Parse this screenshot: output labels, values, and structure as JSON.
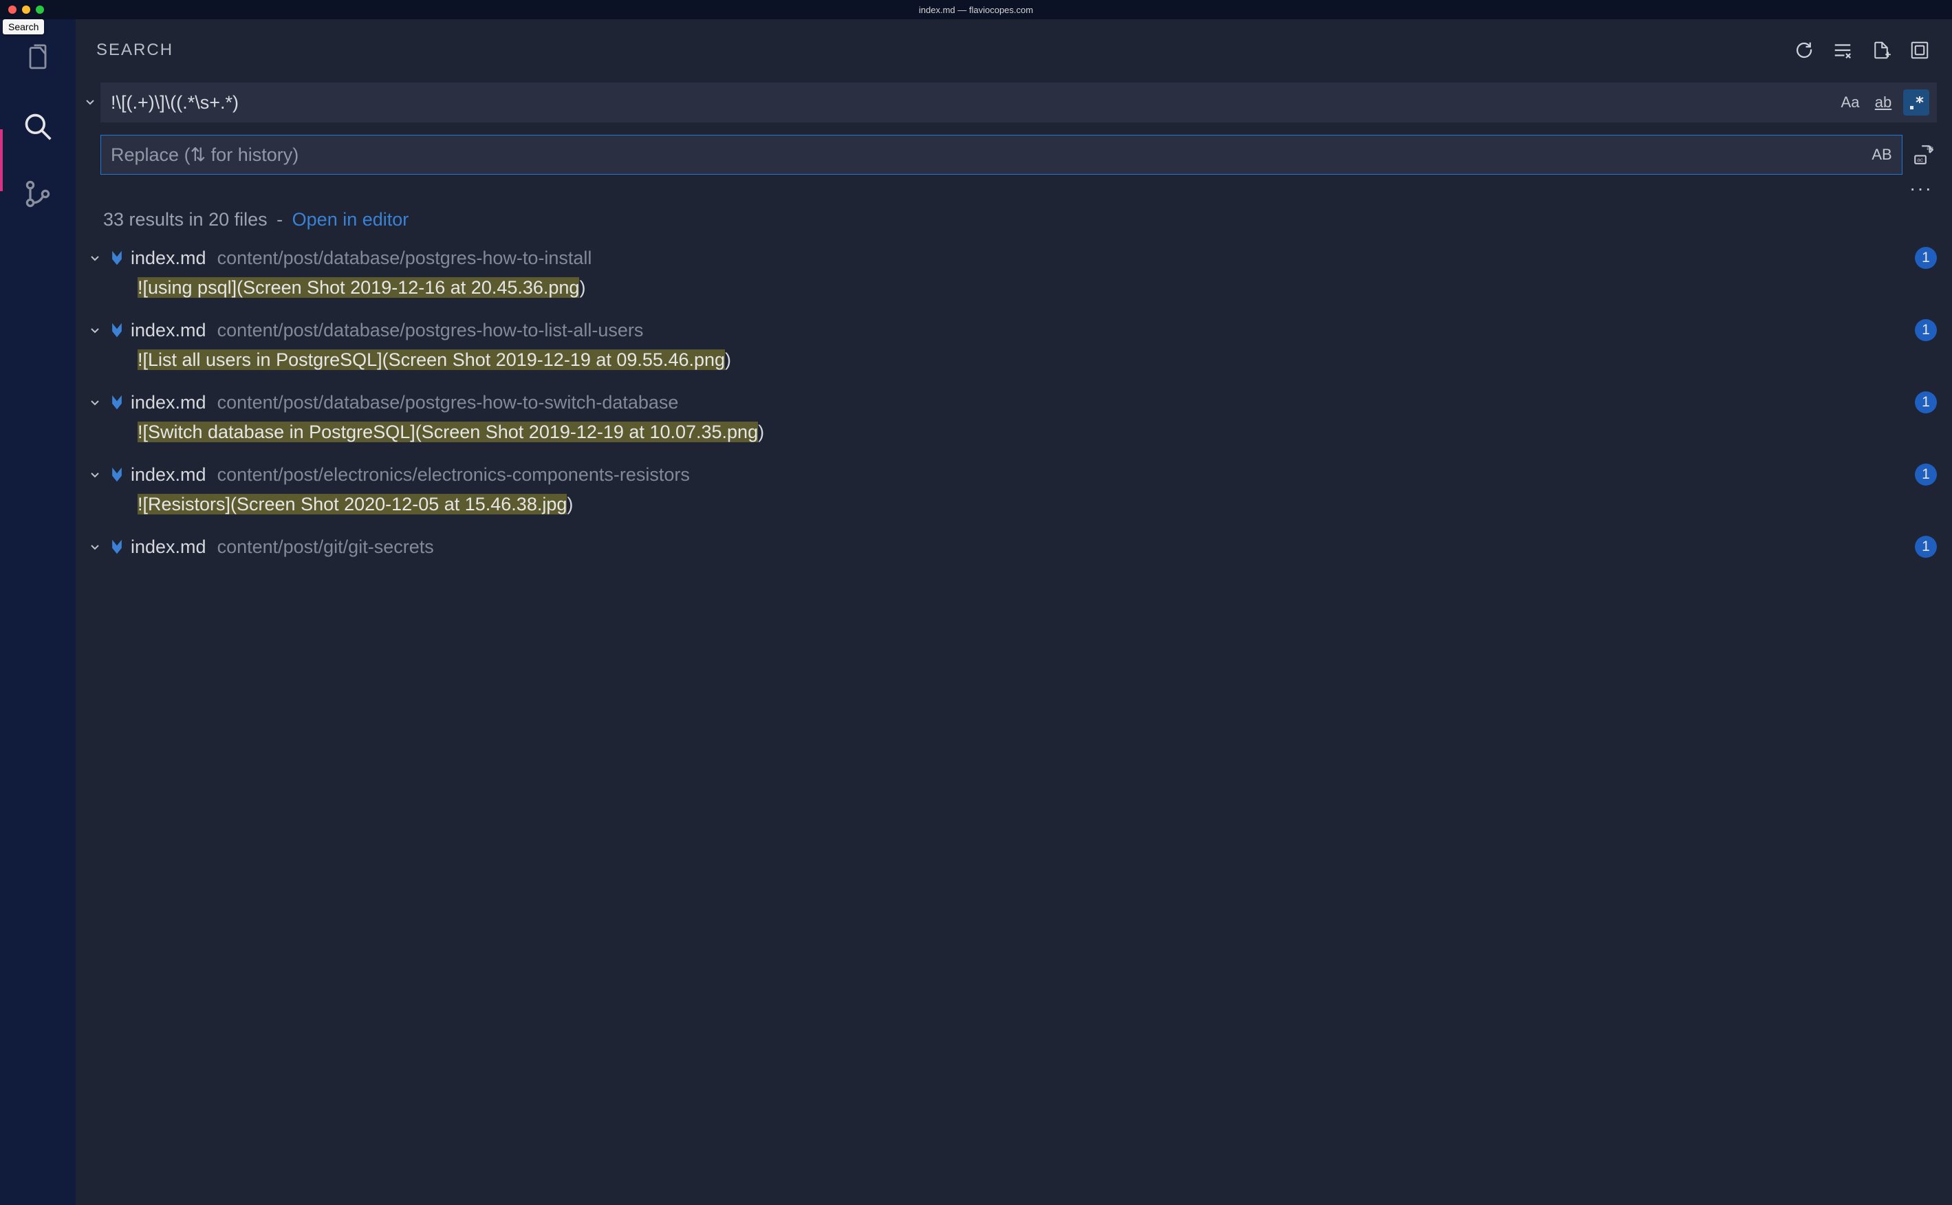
{
  "titlebar": {
    "title": "index.md — flaviocopes.com"
  },
  "tooltip": "Search",
  "sidebar": {
    "title": "SEARCH"
  },
  "search": {
    "query": "!\\[(.+)\\]\\((.*\\s+.*)",
    "replace_placeholder": "Replace (⇅ for history)",
    "match_case_label": "Aa",
    "whole_word_label": "ab",
    "regex_label": ".*",
    "preserve_case_label": "AB"
  },
  "summary": {
    "text": "33 results in 20 files",
    "link": "Open in editor"
  },
  "ellipsis": "···",
  "results": [
    {
      "file": "index.md",
      "path": "content/post/database/postgres-how-to-install",
      "count": "1",
      "match": "![using psql](Screen Shot 2019-12-16 at 20.45.36.png)"
    },
    {
      "file": "index.md",
      "path": "content/post/database/postgres-how-to-list-all-users",
      "count": "1",
      "match": "![List all users in PostgreSQL](Screen Shot 2019-12-19 at 09.55.46.png)"
    },
    {
      "file": "index.md",
      "path": "content/post/database/postgres-how-to-switch-database",
      "count": "1",
      "match": "![Switch database in PostgreSQL](Screen Shot 2019-12-19 at 10.07.35.png)"
    },
    {
      "file": "index.md",
      "path": "content/post/electronics/electronics-components-resistors",
      "count": "1",
      "match": "![Resistors](Screen Shot 2020-12-05 at 15.46.38.jpg)"
    },
    {
      "file": "index.md",
      "path": "content/post/git/git-secrets",
      "count": "1",
      "match": ""
    }
  ]
}
